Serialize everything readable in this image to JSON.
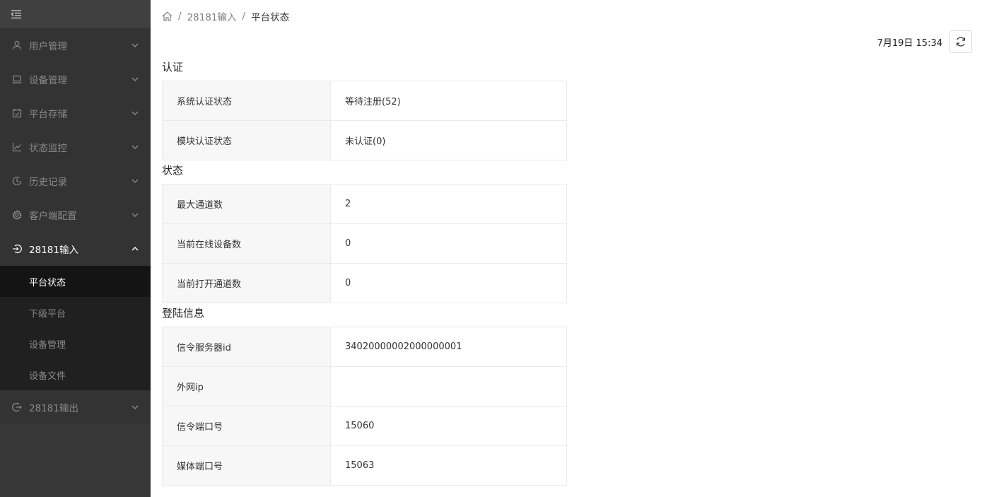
{
  "sidebar": {
    "menu": [
      {
        "label": "用户管理",
        "icon": "user-icon"
      },
      {
        "label": "设备管理",
        "icon": "monitor-icon"
      },
      {
        "label": "平台存储",
        "icon": "calendar-check-icon"
      },
      {
        "label": "状态监控",
        "icon": "line-chart-icon"
      },
      {
        "label": "历史记录",
        "icon": "clock-icon"
      },
      {
        "label": "客户端配置",
        "icon": "gear-icon"
      },
      {
        "label": "28181输入",
        "icon": "login-icon"
      },
      {
        "label": "28181输出",
        "icon": "logout-icon"
      }
    ],
    "submenu": [
      {
        "label": "平台状态",
        "active": true
      },
      {
        "label": "下级平台"
      },
      {
        "label": "设备管理"
      },
      {
        "label": "设备文件"
      }
    ]
  },
  "breadcrumb": {
    "level1": "28181输入",
    "current": "平台状态",
    "separator": "/"
  },
  "timebar": {
    "time": "7月19日 15:34"
  },
  "sections": {
    "auth": {
      "title": "认证",
      "rows": [
        {
          "key": "系统认证状态",
          "value": "等待注册(52)"
        },
        {
          "key": "模块认证状态",
          "value": "未认证(0)"
        }
      ]
    },
    "status": {
      "title": "状态",
      "rows": [
        {
          "key": "最大通道数",
          "value": "2"
        },
        {
          "key": "当前在线设备数",
          "value": "0"
        },
        {
          "key": "当前打开通道数",
          "value": "0"
        }
      ]
    },
    "login": {
      "title": "登陆信息",
      "rows": [
        {
          "key": "信令服务器id",
          "value": "34020000002000000001"
        },
        {
          "key": "外网ip",
          "value": ""
        },
        {
          "key": "信令端口号",
          "value": "15060"
        },
        {
          "key": "媒体端口号",
          "value": "15063"
        }
      ]
    }
  },
  "colors": {
    "sidebar_bg": "#383838",
    "menu_bg": "#333333",
    "submenu_bg": "#202020",
    "submenu_active_bg": "#141414",
    "key_cell_bg": "#f7f7f7"
  }
}
